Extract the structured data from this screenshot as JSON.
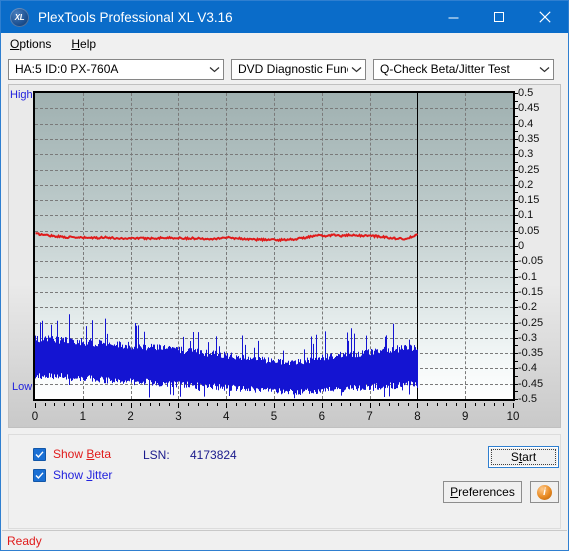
{
  "window": {
    "title": "PlexTools Professional XL V3.16",
    "icon": "XL",
    "minimize_icon": "minimize-icon",
    "maximize_icon": "maximize-icon",
    "close_icon": "close-icon"
  },
  "menu": {
    "items": [
      {
        "label": "Options",
        "accel": "O"
      },
      {
        "label": "Help",
        "accel": "H"
      }
    ]
  },
  "toolbar": {
    "drive_select": "HA:5 ID:0  PX-760A",
    "function_select": "DVD Diagnostic Functions",
    "test_select": "Q-Check Beta/Jitter Test",
    "chevron": "⌄"
  },
  "chart_axis": {
    "high_label": "High",
    "low_label": "Low"
  },
  "controls": {
    "show_beta_label": "Show Beta",
    "show_beta_accel": "B",
    "show_beta_checked": true,
    "show_jitter_label": "Show Jitter",
    "show_jitter_accel": "J",
    "show_jitter_checked": true,
    "lsn_label": "LSN:",
    "lsn_value": "4173824",
    "start_label": "Start",
    "start_accel": "S",
    "preferences_label": "Preferences",
    "preferences_accel": "P",
    "info_label": "i"
  },
  "status": {
    "text": "Ready"
  },
  "colors": {
    "title_bar": "#0a6cc9",
    "beta_line": "#e01b1b",
    "jitter_band": "#1414d2",
    "accent": "#2f7fd0",
    "status_text": "#e01b1b"
  },
  "chart_data": {
    "type": "line",
    "title": "Q-Check Beta/Jitter Test",
    "xlabel": "",
    "ylabel": "",
    "xlim": [
      0,
      10
    ],
    "ylim": [
      -0.5,
      0.5
    ],
    "grid": true,
    "legend_position": "below-left",
    "x_ticks": [
      0,
      1,
      2,
      3,
      4,
      5,
      6,
      7,
      8,
      9,
      10
    ],
    "y_ticks": [
      0.5,
      0.45,
      0.4,
      0.35,
      0.3,
      0.25,
      0.2,
      0.15,
      0.1,
      0.05,
      0,
      -0.05,
      -0.1,
      -0.15,
      -0.2,
      -0.25,
      -0.3,
      -0.35,
      -0.4,
      -0.45,
      -0.5
    ],
    "data_end_x": 8,
    "annotations": [
      {
        "text": "High",
        "position": "top-left-outside",
        "color": "#2222dd"
      },
      {
        "text": "Low",
        "position": "bottom-left-outside",
        "color": "#2222dd"
      }
    ],
    "series": [
      {
        "name": "Beta",
        "color": "#e01b1b",
        "type": "line",
        "x": [
          0.0,
          0.16,
          0.32,
          0.48,
          0.64,
          0.8,
          0.96,
          1.12,
          1.28,
          1.44,
          1.6,
          1.76,
          1.92,
          2.08,
          2.24,
          2.4,
          2.56,
          2.72,
          2.88,
          3.04,
          3.2,
          3.36,
          3.52,
          3.68,
          3.84,
          4.0,
          4.16,
          4.32,
          4.48,
          4.64,
          4.8,
          4.96,
          5.12,
          5.28,
          5.44,
          5.6,
          5.76,
          5.92,
          6.08,
          6.24,
          6.4,
          6.56,
          6.72,
          6.88,
          7.04,
          7.2,
          7.36,
          7.52,
          7.68,
          7.84,
          8.0
        ],
        "values": [
          0.04,
          0.037,
          0.034,
          0.031,
          0.029,
          0.028,
          0.027,
          0.027,
          0.026,
          0.029,
          0.026,
          0.025,
          0.025,
          0.026,
          0.025,
          0.025,
          0.026,
          0.027,
          0.026,
          0.026,
          0.025,
          0.025,
          0.024,
          0.024,
          0.025,
          0.028,
          0.026,
          0.024,
          0.022,
          0.021,
          0.021,
          0.02,
          0.02,
          0.021,
          0.023,
          0.026,
          0.031,
          0.034,
          0.033,
          0.036,
          0.033,
          0.035,
          0.034,
          0.034,
          0.033,
          0.031,
          0.028,
          0.025,
          0.023,
          0.028,
          0.037
        ]
      },
      {
        "name": "Jitter",
        "color": "#1414d2",
        "type": "noise-band",
        "x": [
          0.0,
          0.4,
          0.8,
          1.2,
          1.6,
          2.0,
          2.4,
          2.8,
          3.2,
          3.6,
          4.0,
          4.4,
          4.8,
          5.2,
          5.6,
          6.0,
          6.4,
          6.8,
          7.2,
          7.6,
          8.0
        ],
        "upper": [
          -0.295,
          -0.3,
          -0.305,
          -0.31,
          -0.315,
          -0.32,
          -0.325,
          -0.33,
          -0.338,
          -0.345,
          -0.352,
          -0.36,
          -0.368,
          -0.375,
          -0.372,
          -0.358,
          -0.35,
          -0.345,
          -0.338,
          -0.33,
          -0.325
        ],
        "lower": [
          -0.43,
          -0.432,
          -0.436,
          -0.44,
          -0.444,
          -0.448,
          -0.452,
          -0.456,
          -0.46,
          -0.464,
          -0.468,
          -0.472,
          -0.476,
          -0.48,
          -0.482,
          -0.478,
          -0.474,
          -0.47,
          -0.466,
          -0.462,
          -0.458
        ]
      }
    ]
  }
}
